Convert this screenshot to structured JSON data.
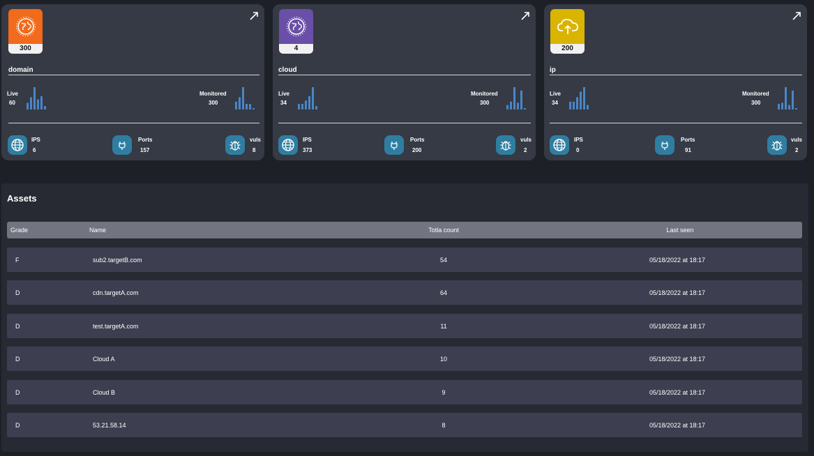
{
  "colors": {
    "domain_tile": "#f26a1b",
    "cloud_tile": "#6a4fa8",
    "ip_tile": "#d9b400",
    "metric_icon_bg": "#2f7ea1",
    "bar": "#4a86c8"
  },
  "cards": [
    {
      "title": "domain",
      "count": "300",
      "icon": "globe-icon",
      "live_label": "Live",
      "live_value": "60",
      "live_bars": [
        0.3,
        0.55,
        1.0,
        0.45,
        0.6,
        0.15
      ],
      "monitored_label": "Monitored",
      "monitored_value": "300",
      "monitored_bars": [
        0.35,
        0.55,
        1.0,
        0.25,
        0.25,
        0.05
      ],
      "ips_label": "IPS",
      "ips_value": "6",
      "ports_label": "Ports",
      "ports_value": "157",
      "vuls_label": "vuls",
      "vuls_value": "8"
    },
    {
      "title": "cloud",
      "count": "4",
      "icon": "globe-icon",
      "live_label": "Live",
      "live_value": "34",
      "live_bars": [
        0.25,
        0.25,
        0.4,
        0.6,
        1.0,
        0.15
      ],
      "monitored_label": "Monitored",
      "monitored_value": "300",
      "monitored_bars": [
        0.2,
        0.35,
        1.0,
        0.3,
        0.85,
        0.05
      ],
      "ips_label": "IPS",
      "ips_value": "373",
      "ports_label": "Ports",
      "ports_value": "200",
      "vuls_label": "vuls",
      "vuls_value": "2"
    },
    {
      "title": "ip",
      "count": "200",
      "icon": "cloud-upload-icon",
      "live_label": "Live",
      "live_value": "34",
      "live_bars": [
        0.35,
        0.35,
        0.55,
        0.8,
        1.0,
        0.2
      ],
      "monitored_label": "Monitored",
      "monitored_value": "300",
      "monitored_bars": [
        0.25,
        0.3,
        1.0,
        0.2,
        0.85,
        0.05
      ],
      "ips_label": "IPS",
      "ips_value": "0",
      "ports_label": "Ports",
      "ports_value": "91",
      "vuls_label": "vuls",
      "vuls_value": "2"
    }
  ],
  "assets": {
    "title": "Assets",
    "columns": [
      "Grade",
      "Name",
      "Totla count",
      "Last seen"
    ],
    "rows": [
      {
        "grade": "F",
        "name": "sub2.targetB.com",
        "count": "54",
        "last_seen": "05/18/2022 at 18:17"
      },
      {
        "grade": "D",
        "name": "cdn.targetA.com",
        "count": "64",
        "last_seen": "05/18/2022 at 18:17"
      },
      {
        "grade": "D",
        "name": "test.targetA.com",
        "count": "11",
        "last_seen": "05/18/2022 at 18:17"
      },
      {
        "grade": "D",
        "name": "Cloud A",
        "count": "10",
        "last_seen": "05/18/2022 at 18:17"
      },
      {
        "grade": "D",
        "name": "Cloud B",
        "count": "9",
        "last_seen": "05/18/2022 at 18:17"
      },
      {
        "grade": "D",
        "name": "53.21.58.14",
        "count": "8",
        "last_seen": "05/18/2022 at 18:17"
      }
    ]
  }
}
